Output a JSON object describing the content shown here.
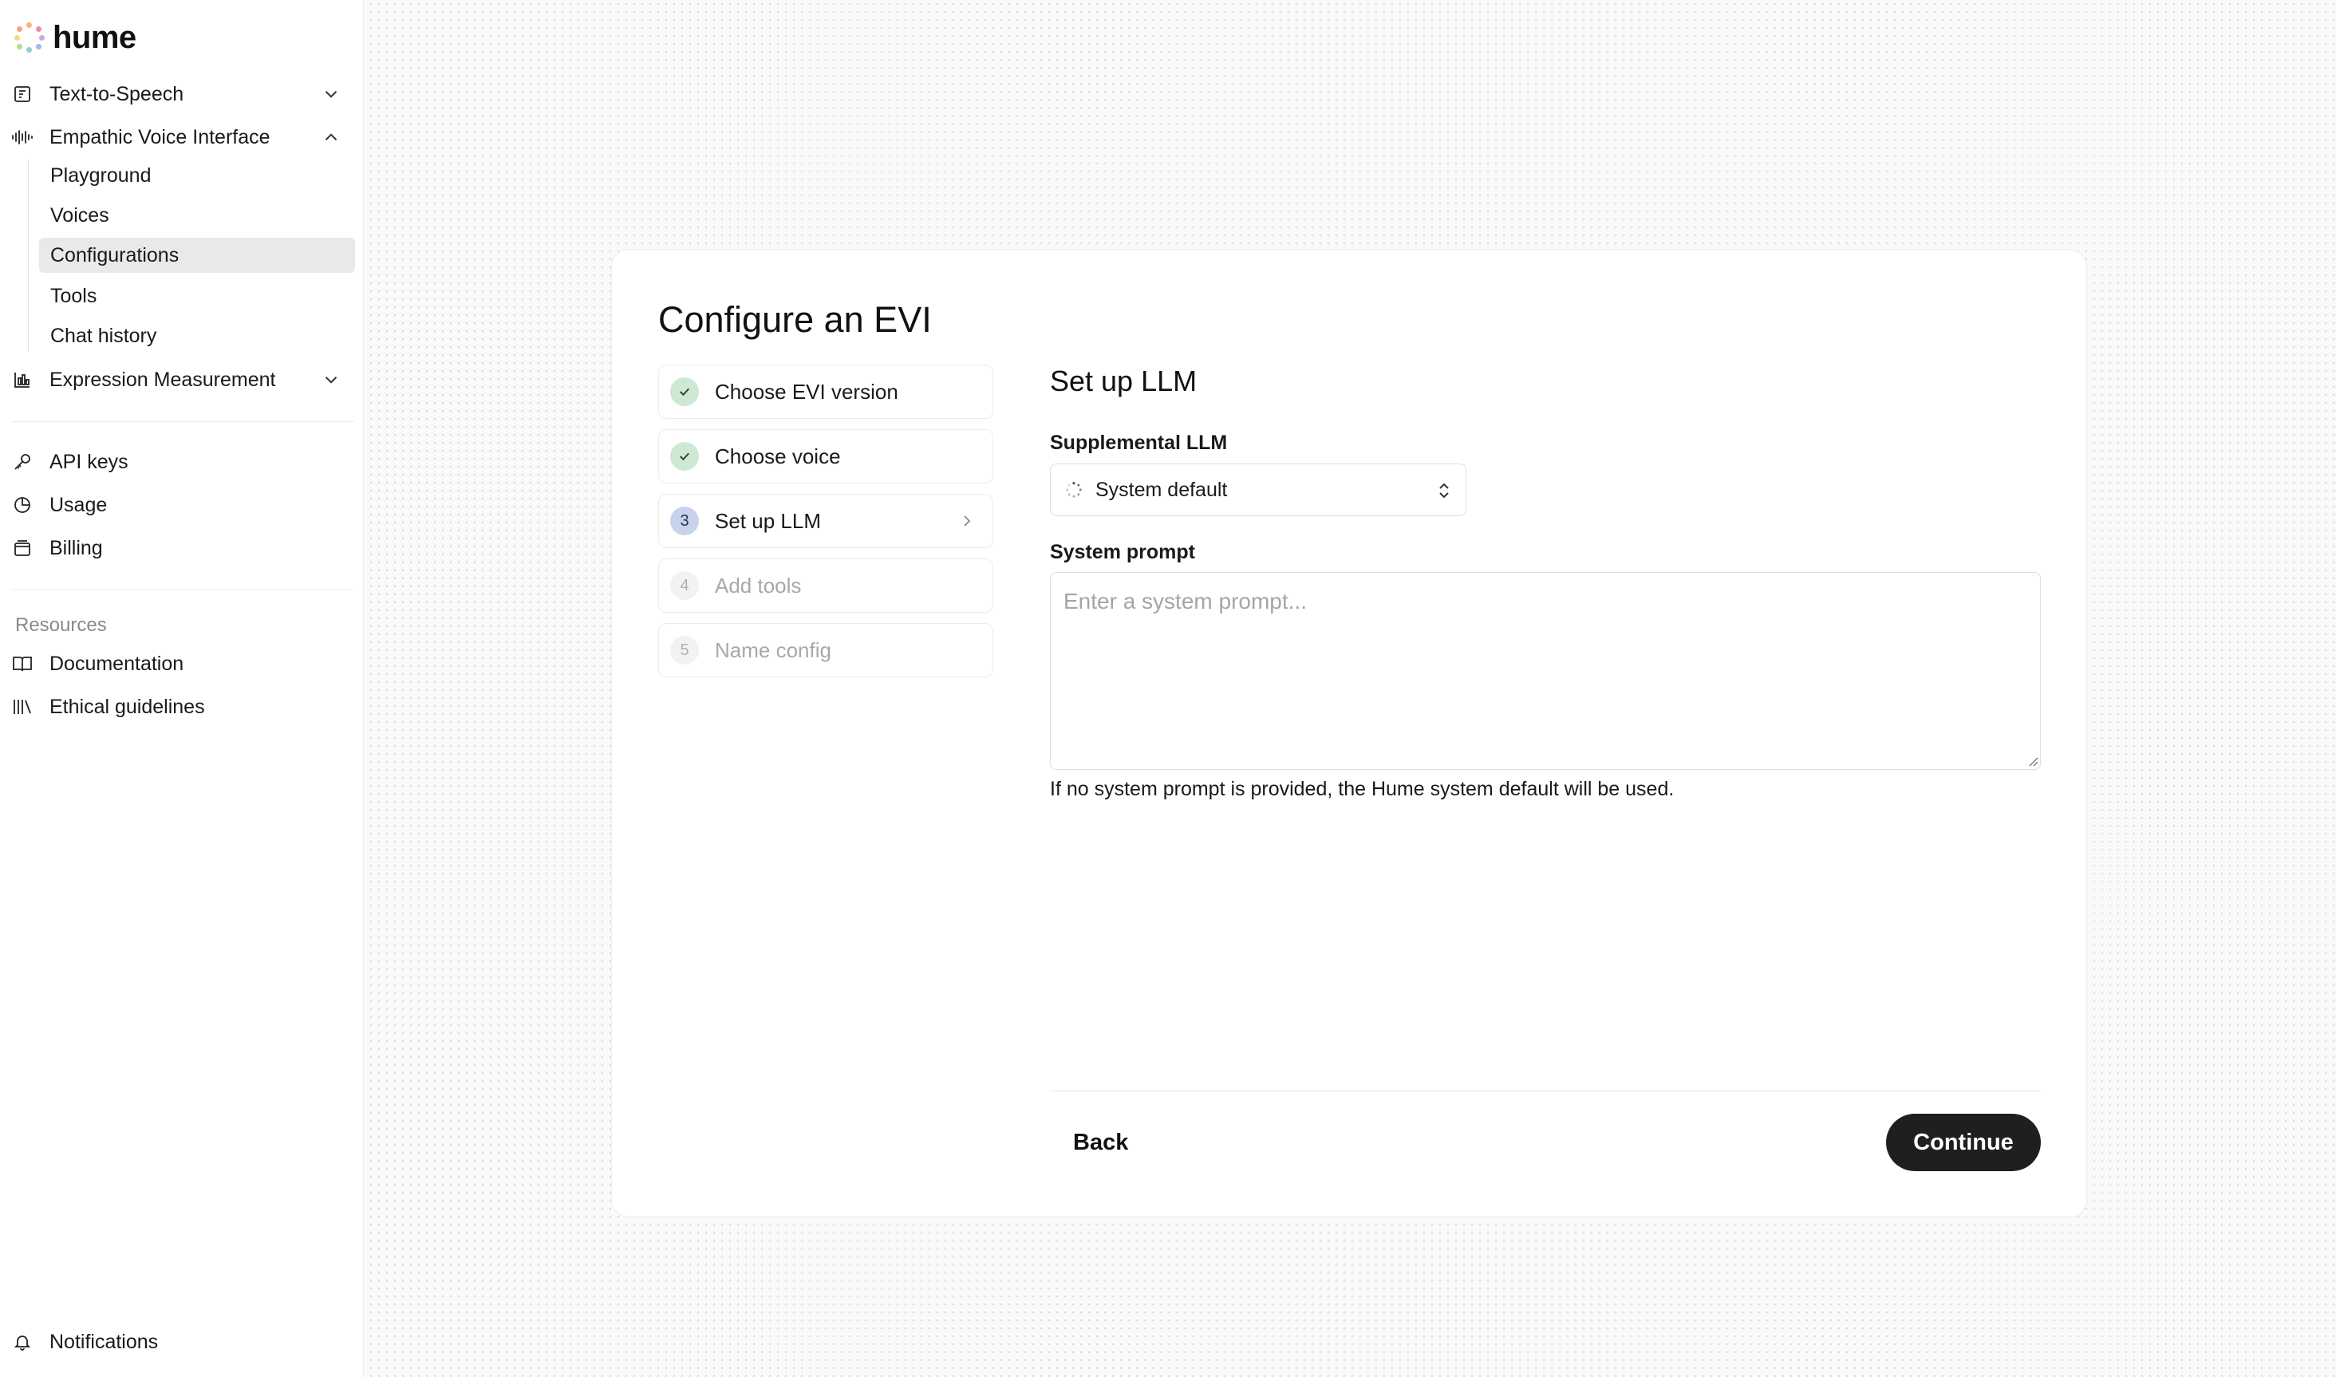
{
  "brand": {
    "name": "hume"
  },
  "sidebar": {
    "items": [
      {
        "label": "Text-to-Speech",
        "icon": "tts-icon",
        "expanded": false
      },
      {
        "label": "Empathic Voice Interface",
        "icon": "waveform-icon",
        "expanded": true
      },
      {
        "label": "Expression Measurement",
        "icon": "bar-chart-icon",
        "expanded": false
      }
    ],
    "evi_subitems": [
      "Playground",
      "Voices",
      "Configurations",
      "Tools",
      "Chat history"
    ],
    "active_subitem": "Configurations",
    "account": [
      {
        "label": "API keys",
        "icon": "key-icon"
      },
      {
        "label": "Usage",
        "icon": "pie-chart-icon"
      },
      {
        "label": "Billing",
        "icon": "billing-icon"
      }
    ],
    "resources_label": "Resources",
    "resources": [
      {
        "label": "Documentation",
        "icon": "book-icon"
      },
      {
        "label": "Ethical guidelines",
        "icon": "library-icon"
      }
    ],
    "notifications": {
      "label": "Notifications",
      "icon": "bell-icon"
    }
  },
  "page": {
    "title": "Configure an EVI",
    "steps": [
      {
        "number": "1",
        "label": "Choose EVI version",
        "status": "done"
      },
      {
        "number": "2",
        "label": "Choose voice",
        "status": "done"
      },
      {
        "number": "3",
        "label": "Set up LLM",
        "status": "current"
      },
      {
        "number": "4",
        "label": "Add tools",
        "status": "upcoming"
      },
      {
        "number": "5",
        "label": "Name config",
        "status": "upcoming"
      }
    ],
    "section_title": "Set up LLM",
    "llm_label": "Supplemental LLM",
    "llm_value": "System default",
    "prompt_label": "System prompt",
    "prompt_placeholder": "Enter a system prompt...",
    "prompt_value": "",
    "helper_text": "If no system prompt is provided, the Hume system default will be used.",
    "back_label": "Back",
    "continue_label": "Continue"
  },
  "colors": {
    "accent_dark": "#1f1f1f",
    "step_done_badge": "#cfe8d2",
    "step_current_badge": "#c7d3ea",
    "active_nav_bg": "#e9e9e9"
  }
}
